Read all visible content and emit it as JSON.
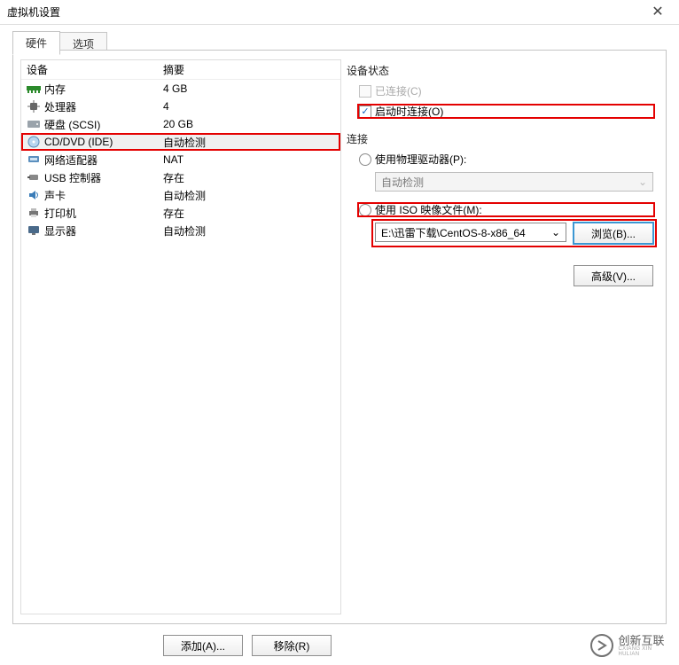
{
  "window": {
    "title": "虚拟机设置"
  },
  "tabs": [
    {
      "label": "硬件",
      "active": true
    },
    {
      "label": "选项",
      "active": false
    }
  ],
  "device_table": {
    "header_device": "设备",
    "header_summary": "摘要",
    "rows": [
      {
        "name": "内存",
        "summary": "4 GB"
      },
      {
        "name": "处理器",
        "summary": "4"
      },
      {
        "name": "硬盘 (SCSI)",
        "summary": "20 GB"
      },
      {
        "name": "CD/DVD (IDE)",
        "summary": "自动检测"
      },
      {
        "name": "网络适配器",
        "summary": "NAT"
      },
      {
        "name": "USB 控制器",
        "summary": "存在"
      },
      {
        "name": "声卡",
        "summary": "自动检测"
      },
      {
        "name": "打印机",
        "summary": "存在"
      },
      {
        "name": "显示器",
        "summary": "自动检测"
      }
    ]
  },
  "device_status": {
    "title": "设备状态",
    "connected_label": "已连接(C)",
    "connect_at_power_on_label": "启动时连接(O)"
  },
  "connection": {
    "title": "连接",
    "use_physical_label": "使用物理驱动器(P):",
    "physical_value": "自动检测",
    "use_iso_label": "使用 ISO 映像文件(M):",
    "iso_value": "E:\\迅雷下载\\CentOS-8-x86_64",
    "browse_label": "浏览(B)..."
  },
  "buttons": {
    "advanced": "高级(V)...",
    "add": "添加(A)...",
    "remove": "移除(R)"
  },
  "watermark": {
    "text_big": "创新互联",
    "text_small": "CXIANG XIN HULIAN"
  }
}
